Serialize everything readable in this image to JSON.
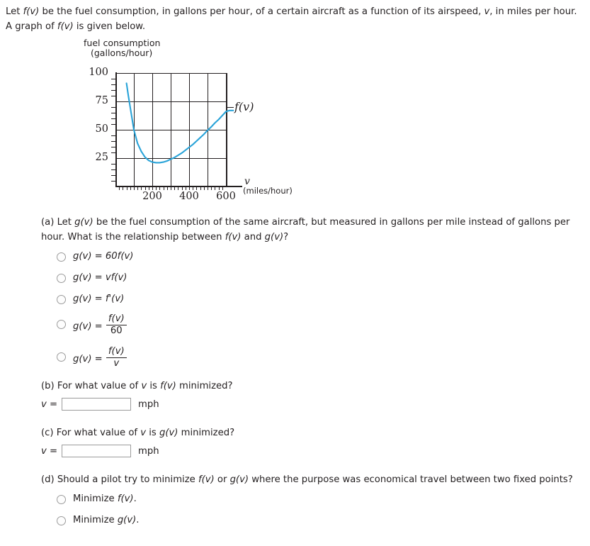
{
  "prompt": {
    "line1_a": "Let ",
    "line1_fn": "f(v)",
    "line1_b": " be the fuel consumption, in gallons per hour, of a certain aircraft as a function of its airspeed, ",
    "line1_var": "v",
    "line1_c": ", in miles per hour. A graph of ",
    "line1_fn2": "f(v)",
    "line1_d": " is given below."
  },
  "figure": {
    "title_line1": "fuel consumption",
    "title_line2": "(gallons/hour)",
    "curve_label": "f(v)",
    "x_axis_name": "v",
    "x_axis_units": "(miles/hour)"
  },
  "chart_data": {
    "type": "line",
    "title": "fuel consumption (gallons/hour)",
    "xlabel": "v (miles/hour)",
    "ylabel": "fuel consumption (gallons/hour)",
    "xlim": [
      0,
      700
    ],
    "ylim": [
      0,
      100
    ],
    "xticks": [
      200,
      400,
      600
    ],
    "xtick_labels": [
      "200",
      "400",
      "600"
    ],
    "yticks": [
      25,
      50,
      75,
      100
    ],
    "ytick_labels": [
      "25",
      "50",
      "75",
      "100"
    ],
    "x_minor_tick_step": 20,
    "y_minor_tick_step": 5,
    "grid": true,
    "grid_x_values": [
      100,
      200,
      300,
      400,
      500,
      600
    ],
    "grid_y_values": [
      25,
      50,
      75,
      100
    ],
    "legend_position": "right-of-curve",
    "series": [
      {
        "name": "f(v)",
        "color": "#29a3d8",
        "x": [
          60,
          70,
          80,
          90,
          100,
          120,
          140,
          160,
          180,
          200,
          220,
          240,
          260,
          280,
          300,
          320,
          340,
          360,
          380,
          400,
          420,
          440,
          460,
          480,
          500,
          520,
          540,
          560,
          580,
          600,
          620,
          640
        ],
        "y": [
          91,
          80,
          70,
          60,
          50,
          38,
          31,
          26,
          23,
          21.5,
          21,
          21,
          21.5,
          22.5,
          24,
          25.5,
          27.5,
          29.5,
          32,
          34.5,
          37,
          40,
          43,
          46,
          49.5,
          52.5,
          56,
          59,
          62.5,
          66,
          67,
          67
        ]
      }
    ],
    "annotations": [
      {
        "text": "f(v)",
        "x": 680,
        "y": 75
      }
    ]
  },
  "question_a": {
    "label": "(a) Let ",
    "fn_g": "g(v)",
    "text_1": " be the fuel consumption of the same aircraft, but measured in gallons per mile instead of gallons per hour. What is the relationship between ",
    "fn_f": "f(v)",
    "text_2": " and ",
    "fn_g2": "g(v)",
    "text_3": "?",
    "choices": [
      {
        "id": "a1",
        "lhs": "g(v)",
        "eq": " = ",
        "rhs": "60f(v)",
        "kind": "plain"
      },
      {
        "id": "a2",
        "lhs": "g(v)",
        "eq": " = ",
        "rhs": "vf(v)",
        "kind": "plain"
      },
      {
        "id": "a3",
        "lhs": "g(v)",
        "eq": " = ",
        "rhs": "f'(v)",
        "kind": "plain"
      },
      {
        "id": "a4",
        "lhs": "g(v)",
        "eq": " = ",
        "num": "f(v)",
        "den": "60",
        "kind": "fraction"
      },
      {
        "id": "a5",
        "lhs": "g(v)",
        "eq": " = ",
        "num": "f(v)",
        "den": "v",
        "kind": "fraction"
      }
    ]
  },
  "question_b": {
    "label": "(b) For what value of ",
    "var": "v",
    "text_1": " is ",
    "fn": "f(v)",
    "text_2": " minimized?",
    "answer_prefix": "v =",
    "answer_value": "",
    "answer_placeholder": "",
    "unit": "mph"
  },
  "question_c": {
    "label": "(c) For what value of ",
    "var": "v",
    "text_1": " is ",
    "fn": "g(v)",
    "text_2": " minimized?",
    "answer_prefix": "v =",
    "answer_value": "",
    "answer_placeholder": "",
    "unit": "mph"
  },
  "question_d": {
    "label": "(d) Should a pilot try to minimize ",
    "fn_f": "f(v)",
    "text_1": " or ",
    "fn_g": "g(v)",
    "text_2": " where the purpose was economical travel between two fixed points?",
    "choices": [
      {
        "id": "d1",
        "pre": "Minimize ",
        "fn": "f(v)",
        "post": "."
      },
      {
        "id": "d2",
        "pre": "Minimize ",
        "fn": "g(v)",
        "post": "."
      }
    ]
  },
  "colors": {
    "curve": "#29a3d8",
    "ink": "#231f20",
    "field_border": "#9b9b9b"
  }
}
